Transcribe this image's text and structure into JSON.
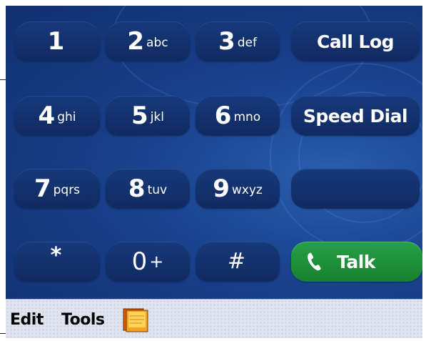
{
  "keypad": {
    "keys": [
      {
        "digit": "1",
        "letters": ""
      },
      {
        "digit": "2",
        "letters": "abc"
      },
      {
        "digit": "3",
        "letters": "def"
      },
      {
        "digit": "4",
        "letters": "ghi"
      },
      {
        "digit": "5",
        "letters": "jkl"
      },
      {
        "digit": "6",
        "letters": "mno"
      },
      {
        "digit": "7",
        "letters": "pqrs"
      },
      {
        "digit": "8",
        "letters": "tuv"
      },
      {
        "digit": "9",
        "letters": "wxyz"
      },
      {
        "digit": "*",
        "letters": ""
      },
      {
        "digit": "0",
        "letters": "+"
      },
      {
        "digit": "#",
        "letters": ""
      }
    ],
    "call_log_label": "Call Log",
    "speed_dial_label": "Speed Dial",
    "blank_label": "",
    "talk_label": "Talk"
  },
  "toolbar": {
    "edit_label": "Edit",
    "tools_label": "Tools",
    "tools_icon": "notes-icon"
  },
  "colors": {
    "keypad_bg": "#173c85",
    "key_bg": "#102a62",
    "talk_bg": "#1f8f3a",
    "toolbar_bg": "#dfe5ef"
  }
}
